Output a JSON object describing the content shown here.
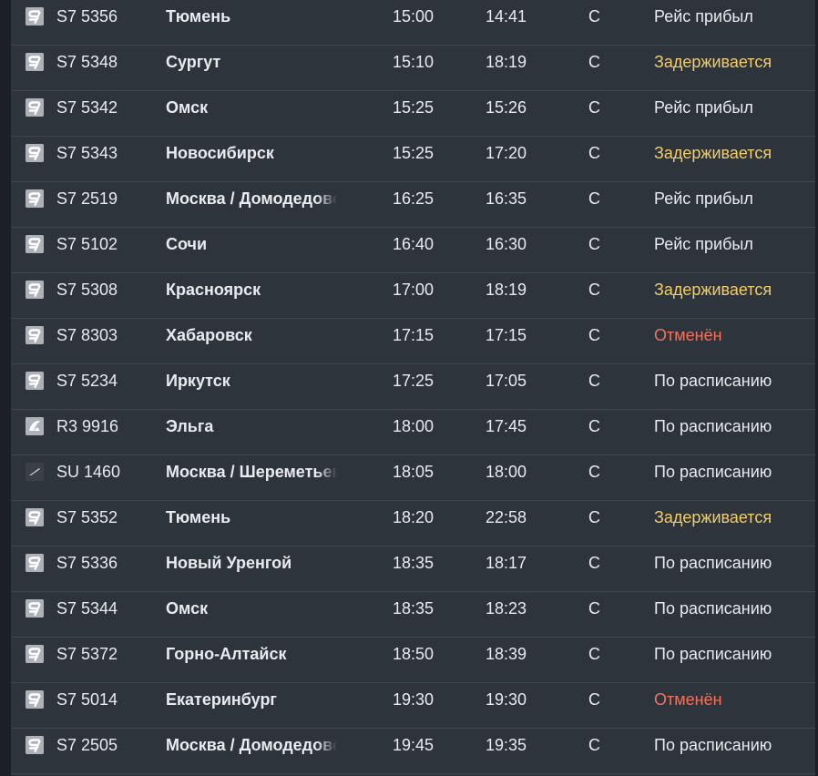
{
  "colors": {
    "background": "#2e343c",
    "text": "#e9ebee",
    "delayed": "#f1cd6b",
    "cancelled": "#f0735e",
    "row_divider": "#40464f"
  },
  "flights": [
    {
      "logo": "s7-logo-icon",
      "flight": "S7 5356",
      "city": "Тюмень",
      "sched": "15:00",
      "actual": "14:41",
      "terminal": "C",
      "status": "Рейс прибыл",
      "status_type": "ok"
    },
    {
      "logo": "s7-logo-icon",
      "flight": "S7 5348",
      "city": "Сургут",
      "sched": "15:10",
      "actual": "18:19",
      "terminal": "C",
      "status": "Задерживается",
      "status_type": "delayed"
    },
    {
      "logo": "s7-logo-icon",
      "flight": "S7 5342",
      "city": "Омск",
      "sched": "15:25",
      "actual": "15:26",
      "terminal": "C",
      "status": "Рейс прибыл",
      "status_type": "ok"
    },
    {
      "logo": "s7-logo-icon",
      "flight": "S7 5343",
      "city": "Новосибирск",
      "sched": "15:25",
      "actual": "17:20",
      "terminal": "C",
      "status": "Задерживается",
      "status_type": "delayed"
    },
    {
      "logo": "s7-logo-icon",
      "flight": "S7 2519",
      "city": "Москва / Домодедово",
      "sched": "16:25",
      "actual": "16:35",
      "terminal": "C",
      "status": "Рейс прибыл",
      "status_type": "ok"
    },
    {
      "logo": "s7-logo-icon",
      "flight": "S7 5102",
      "city": "Сочи",
      "sched": "16:40",
      "actual": "16:30",
      "terminal": "C",
      "status": "Рейс прибыл",
      "status_type": "ok"
    },
    {
      "logo": "s7-logo-icon",
      "flight": "S7 5308",
      "city": "Красноярск",
      "sched": "17:00",
      "actual": "18:19",
      "terminal": "C",
      "status": "Задерживается",
      "status_type": "delayed"
    },
    {
      "logo": "s7-logo-icon",
      "flight": "S7 8303",
      "city": "Хабаровск",
      "sched": "17:15",
      "actual": "17:15",
      "terminal": "C",
      "status": "Отменён",
      "status_type": "cancelled"
    },
    {
      "logo": "s7-logo-icon",
      "flight": "S7 5234",
      "city": "Иркутск",
      "sched": "17:25",
      "actual": "17:05",
      "terminal": "C",
      "status": "По расписанию",
      "status_type": "ok"
    },
    {
      "logo": "r3-logo-icon",
      "flight": "R3 9916",
      "city": "Эльга",
      "sched": "18:00",
      "actual": "17:45",
      "terminal": "C",
      "status": "По расписанию",
      "status_type": "ok"
    },
    {
      "logo": "su-logo-icon",
      "flight": "SU 1460",
      "city": "Москва / Шереметьево",
      "sched": "18:05",
      "actual": "18:00",
      "terminal": "C",
      "status": "По расписанию",
      "status_type": "ok"
    },
    {
      "logo": "s7-logo-icon",
      "flight": "S7 5352",
      "city": "Тюмень",
      "sched": "18:20",
      "actual": "22:58",
      "terminal": "C",
      "status": "Задерживается",
      "status_type": "delayed"
    },
    {
      "logo": "s7-logo-icon",
      "flight": "S7 5336",
      "city": "Новый Уренгой",
      "sched": "18:35",
      "actual": "18:17",
      "terminal": "C",
      "status": "По расписанию",
      "status_type": "ok"
    },
    {
      "logo": "s7-logo-icon",
      "flight": "S7 5344",
      "city": "Омск",
      "sched": "18:35",
      "actual": "18:23",
      "terminal": "C",
      "status": "По расписанию",
      "status_type": "ok"
    },
    {
      "logo": "s7-logo-icon",
      "flight": "S7 5372",
      "city": "Горно-Алтайск",
      "sched": "18:50",
      "actual": "18:39",
      "terminal": "C",
      "status": "По расписанию",
      "status_type": "ok"
    },
    {
      "logo": "s7-logo-icon",
      "flight": "S7 5014",
      "city": "Екатеринбург",
      "sched": "19:30",
      "actual": "19:30",
      "terminal": "C",
      "status": "Отменён",
      "status_type": "cancelled"
    },
    {
      "logo": "s7-logo-icon",
      "flight": "S7 2505",
      "city": "Москва / Домодедово",
      "sched": "19:45",
      "actual": "19:35",
      "terminal": "C",
      "status": "По расписанию",
      "status_type": "ok"
    }
  ]
}
